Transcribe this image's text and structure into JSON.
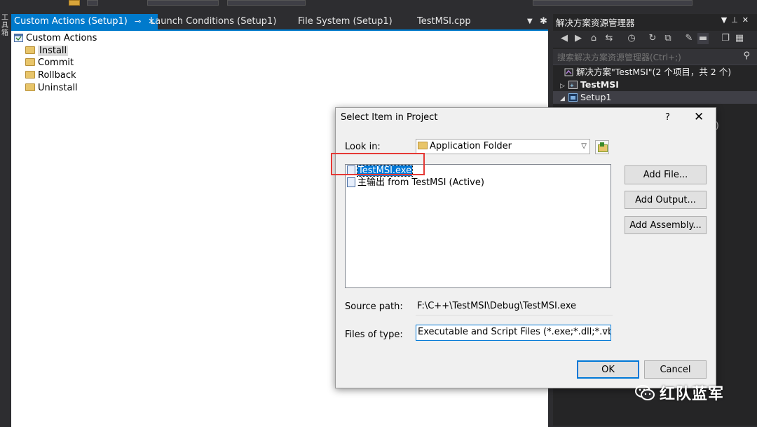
{
  "tabs": [
    {
      "label": "Custom Actions (Setup1)",
      "active": true
    },
    {
      "label": "Launch Conditions (Setup1)",
      "active": false
    },
    {
      "label": "File System (Setup1)",
      "active": false
    },
    {
      "label": "TestMSI.cpp",
      "active": false
    }
  ],
  "left_strip_text": "工具箱",
  "editor_tree": {
    "root": "Custom Actions",
    "items": [
      "Install",
      "Commit",
      "Rollback",
      "Uninstall"
    ],
    "selected": "Install"
  },
  "solution_explorer": {
    "title": "解决方案资源管理器",
    "search_placeholder": "搜索解决方案资源管理器(Ctrl+;)",
    "rows": [
      {
        "label": "解决方案\"TestMSI\"(2 个项目，共 2 个)"
      },
      {
        "label": "TestMSI"
      },
      {
        "label": "Setup1"
      }
    ],
    "hidden_fragment": ")"
  },
  "dialog": {
    "title": "Select Item in Project",
    "help": "?",
    "close": "✕",
    "look_in_label": "Look in:",
    "look_in_value": "Application Folder",
    "files": [
      {
        "name": "TestMSI.exe",
        "selected": true
      },
      {
        "name": "主输出 from TestMSI (Active)",
        "selected": false
      }
    ],
    "buttons": {
      "add_file": "Add File...",
      "add_output": "Add Output...",
      "add_assembly": "Add Assembly...",
      "ok": "OK",
      "cancel": "Cancel"
    },
    "source_path_label": "Source path:",
    "source_path_value": "F:\\C++\\TestMSI\\Debug\\TestMSI.exe",
    "files_of_type_label": "Files of type:",
    "files_of_type_value": "Executable and Script Files (*.exe;*.dll;*.vbs;*"
  },
  "watermark": "红队蓝军",
  "colors": {
    "accent": "#007acc",
    "highlight": "#e53935",
    "selection": "#0078d7"
  }
}
